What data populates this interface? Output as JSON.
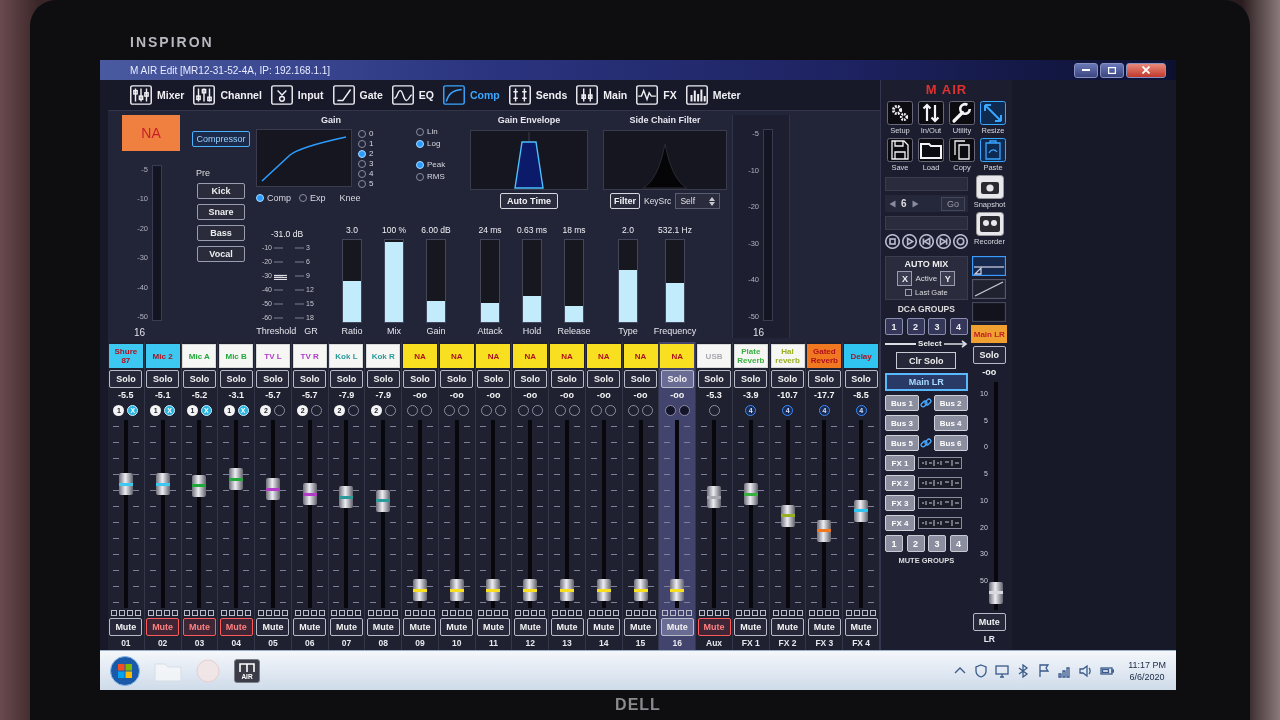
{
  "bezel": {
    "brand": "INSPIRON",
    "logo": "DELL"
  },
  "window": {
    "title": "M AIR Edit [MR12-31-52-4A, IP: 192.168.1.1]"
  },
  "tabs": [
    {
      "label": "Mixer",
      "selected": false
    },
    {
      "label": "Channel",
      "selected": false
    },
    {
      "label": "Input",
      "selected": false
    },
    {
      "label": "Gate",
      "selected": false
    },
    {
      "label": "EQ",
      "selected": false
    },
    {
      "label": "Comp",
      "selected": true
    },
    {
      "label": "Sends",
      "selected": false
    },
    {
      "label": "Main",
      "selected": false
    },
    {
      "label": "FX",
      "selected": false
    },
    {
      "label": "Meter",
      "selected": false
    }
  ],
  "channel_strip": {
    "label": "NA",
    "input_meter": {
      "scale": [
        "-5",
        "-10",
        "-20",
        "-30",
        "-40",
        "-50"
      ],
      "number": "16"
    }
  },
  "compressor": {
    "power": {
      "label": "Compressor",
      "on": true
    },
    "presets": {
      "title": "Pre",
      "buttons": [
        "Kick",
        "Snare",
        "Bass",
        "Vocal"
      ]
    },
    "gain": {
      "title": "Gain",
      "knee": [
        {
          "label": "0",
          "selected": false
        },
        {
          "label": "1",
          "selected": false
        },
        {
          "label": "2",
          "selected": true
        },
        {
          "label": "3",
          "selected": false
        },
        {
          "label": "4",
          "selected": false
        },
        {
          "label": "5",
          "selected": false
        }
      ],
      "modes": [
        {
          "label": "Comp",
          "selected": true
        },
        {
          "label": "Exp",
          "selected": false
        }
      ],
      "knee_label": "Knee"
    },
    "curve": [
      {
        "label": "Lin",
        "selected": false
      },
      {
        "label": "Log",
        "selected": true
      }
    ],
    "detector": [
      {
        "label": "Peak",
        "selected": true
      },
      {
        "label": "RMS",
        "selected": false
      }
    ],
    "envelope": {
      "title": "Gain Envelope",
      "auto_time": "Auto Time"
    },
    "sidechain": {
      "title": "Side Chain Filter",
      "filter": "Filter",
      "key_source_label": "KeySrc",
      "key_source": "Self"
    },
    "threshold": {
      "label": "Threshold",
      "value": "-31.0 dB",
      "level": 0.58,
      "scale": [
        "-10",
        "-20",
        "-30",
        "-40",
        "-50",
        "-60"
      ]
    },
    "gr": {
      "label": "GR",
      "scale": [
        "3",
        "6",
        "9",
        "12",
        "15",
        "18"
      ]
    },
    "slider_groups": [
      [
        {
          "label": "Ratio",
          "value": "3.0",
          "level": 0.5
        },
        {
          "label": "Mix",
          "value": "100 %",
          "level": 0.98
        },
        {
          "label": "Gain",
          "value": "6.00 dB",
          "level": 0.26
        }
      ],
      [
        {
          "label": "Attack",
          "value": "24 ms",
          "level": 0.23
        },
        {
          "label": "Hold",
          "value": "0.63 ms",
          "level": 0.32
        },
        {
          "label": "Release",
          "value": "18 ms",
          "level": 0.19
        }
      ],
      [
        {
          "label": "Type",
          "value": "2.0",
          "level": 0.64
        },
        {
          "label": "Frequency",
          "value": "532.1 Hz",
          "level": 0.47
        }
      ]
    ],
    "output_meter": {
      "scale": [
        "-5",
        "-10",
        "-20",
        "-30",
        "-40",
        "-50"
      ],
      "number": "16"
    }
  },
  "strips": [
    {
      "name": "Shure 87",
      "kind": "filled",
      "color": "#3cc8f0",
      "selected": false,
      "solo": "Solo",
      "value": "-5.5",
      "badges": [
        {
          "kind": "dca",
          "label": "1"
        },
        {
          "kind": "automix",
          "label": "X"
        }
      ],
      "level": 0.68,
      "mute": "Mute",
      "muted": false,
      "number": "01"
    },
    {
      "name": "Mic 2",
      "kind": "filled",
      "color": "#3cc8f0",
      "selected": false,
      "solo": "Solo",
      "value": "-5.1",
      "badges": [
        {
          "kind": "dca",
          "label": "1"
        },
        {
          "kind": "automix",
          "label": "X"
        }
      ],
      "level": 0.68,
      "mute": "Mute",
      "muted": true,
      "number": "02"
    },
    {
      "name": "Mic A",
      "kind": "text",
      "color": "#22a83a",
      "selected": false,
      "solo": "Solo",
      "value": "-5.2",
      "badges": [
        {
          "kind": "dca",
          "label": "1"
        },
        {
          "kind": "automix",
          "label": "X"
        }
      ],
      "level": 0.67,
      "mute": "Mute",
      "muted": true,
      "number": "03"
    },
    {
      "name": "Mic B",
      "kind": "text",
      "color": "#22a83a",
      "selected": false,
      "solo": "Solo",
      "value": "-3.1",
      "badges": [
        {
          "kind": "dca",
          "label": "1"
        },
        {
          "kind": "automix",
          "label": "X"
        }
      ],
      "level": 0.71,
      "mute": "Mute",
      "muted": true,
      "number": "04"
    },
    {
      "name": "TV L",
      "kind": "text",
      "color": "#b23cc8",
      "selected": false,
      "solo": "Solo",
      "value": "-5.7",
      "badges": [
        {
          "kind": "dca",
          "label": "2"
        },
        {
          "kind": "empty"
        }
      ],
      "level": 0.65,
      "mute": "Mute",
      "muted": false,
      "number": "05"
    },
    {
      "name": "TV R",
      "kind": "text",
      "color": "#b23cc8",
      "selected": false,
      "solo": "Solo",
      "value": "-5.7",
      "badges": [
        {
          "kind": "dca",
          "label": "2"
        },
        {
          "kind": "empty"
        }
      ],
      "level": 0.62,
      "mute": "Mute",
      "muted": false,
      "number": "06"
    },
    {
      "name": "Kok L",
      "kind": "text",
      "color": "#2a9a9a",
      "selected": false,
      "solo": "Solo",
      "value": "-7.9",
      "badges": [
        {
          "kind": "dca",
          "label": "2"
        },
        {
          "kind": "empty"
        }
      ],
      "level": 0.6,
      "mute": "Mute",
      "muted": false,
      "number": "07"
    },
    {
      "name": "Kok R",
      "kind": "text",
      "color": "#2a9a9a",
      "selected": false,
      "solo": "Solo",
      "value": "-7.9",
      "badges": [
        {
          "kind": "dca",
          "label": "2"
        },
        {
          "kind": "empty"
        }
      ],
      "level": 0.58,
      "mute": "Mute",
      "muted": false,
      "number": "08"
    },
    {
      "name": "NA",
      "kind": "filled",
      "color": "#f8e020",
      "selected": false,
      "solo": "Solo",
      "value": "-oo",
      "badges": [
        {
          "kind": "empty"
        },
        {
          "kind": "empty"
        }
      ],
      "level": 0.04,
      "mute": "Mute",
      "muted": false,
      "number": "09"
    },
    {
      "name": "NA",
      "kind": "filled",
      "color": "#f8e020",
      "selected": false,
      "solo": "Solo",
      "value": "-oo",
      "badges": [
        {
          "kind": "empty"
        },
        {
          "kind": "empty"
        }
      ],
      "level": 0.04,
      "mute": "Mute",
      "muted": false,
      "number": "10"
    },
    {
      "name": "NA",
      "kind": "filled",
      "color": "#f8e020",
      "selected": false,
      "solo": "Solo",
      "value": "-oo",
      "badges": [
        {
          "kind": "empty"
        },
        {
          "kind": "empty"
        }
      ],
      "level": 0.04,
      "mute": "Mute",
      "muted": false,
      "number": "11"
    },
    {
      "name": "NA",
      "kind": "filled",
      "color": "#f8e020",
      "selected": false,
      "solo": "Solo",
      "value": "-oo",
      "badges": [
        {
          "kind": "empty"
        },
        {
          "kind": "empty"
        }
      ],
      "level": 0.04,
      "mute": "Mute",
      "muted": false,
      "number": "12"
    },
    {
      "name": "NA",
      "kind": "filled",
      "color": "#f8e020",
      "selected": false,
      "solo": "Solo",
      "value": "-oo",
      "badges": [
        {
          "kind": "empty"
        },
        {
          "kind": "empty"
        }
      ],
      "level": 0.04,
      "mute": "Mute",
      "muted": false,
      "number": "13"
    },
    {
      "name": "NA",
      "kind": "filled",
      "color": "#f8e020",
      "selected": false,
      "solo": "Solo",
      "value": "-oo",
      "badges": [
        {
          "kind": "empty"
        },
        {
          "kind": "empty"
        }
      ],
      "level": 0.04,
      "mute": "Mute",
      "muted": false,
      "number": "14"
    },
    {
      "name": "NA",
      "kind": "filled",
      "color": "#f8e020",
      "selected": false,
      "solo": "Solo",
      "value": "-oo",
      "badges": [
        {
          "kind": "empty"
        },
        {
          "kind": "empty"
        }
      ],
      "level": 0.04,
      "mute": "Mute",
      "muted": false,
      "number": "15"
    },
    {
      "name": "NA",
      "kind": "filled",
      "color": "#f8e020",
      "selected": true,
      "solo": "Solo",
      "value": "-oo",
      "badges": [
        {
          "kind": "empty"
        },
        {
          "kind": "empty"
        }
      ],
      "level": 0.04,
      "mute": "Mute",
      "muted": false,
      "number": "16"
    },
    {
      "name": "USB",
      "kind": "text",
      "color": "#a8a8b0",
      "selected": false,
      "solo": "Solo",
      "value": "-5.3",
      "badges": [
        {
          "kind": "empty"
        }
      ],
      "level": 0.6,
      "mute": "Mute",
      "muted": true,
      "number": "Aux"
    },
    {
      "name": "Plate Reverb",
      "kind": "text",
      "color": "#3ab040",
      "selected": false,
      "solo": "Solo",
      "value": "-3.9",
      "badges": [
        {
          "kind": "mute_group",
          "label": "4"
        }
      ],
      "level": 0.62,
      "mute": "Mute",
      "muted": false,
      "number": "FX 1"
    },
    {
      "name": "Hal reverb",
      "kind": "text",
      "color": "#98b020",
      "selected": false,
      "solo": "Solo",
      "value": "-10.7",
      "badges": [
        {
          "kind": "mute_group",
          "label": "4"
        }
      ],
      "level": 0.49,
      "mute": "Mute",
      "muted": false,
      "number": "FX 2"
    },
    {
      "name": "Gated Reverb",
      "kind": "filled",
      "color": "#f07820",
      "selected": false,
      "solo": "Solo",
      "value": "-17.7",
      "badges": [
        {
          "kind": "mute_group",
          "label": "4"
        }
      ],
      "level": 0.4,
      "mute": "Mute",
      "muted": false,
      "number": "FX 3"
    },
    {
      "name": "Delay",
      "kind": "filled",
      "color": "#30c4f0",
      "selected": false,
      "solo": "Solo",
      "value": "-8.5",
      "badges": [
        {
          "kind": "mute_group",
          "label": "4"
        }
      ],
      "level": 0.52,
      "mute": "Mute",
      "muted": false,
      "number": "FX 4"
    }
  ],
  "side_panel": {
    "logo": "M AIR",
    "tools": [
      {
        "label": "Setup",
        "selected": false
      },
      {
        "label": "In/Out",
        "selected": false
      },
      {
        "label": "Utility",
        "selected": false
      },
      {
        "label": "Resize",
        "selected": true
      },
      {
        "label": "Save",
        "selected": false
      },
      {
        "label": "Load",
        "selected": false
      },
      {
        "label": "Copy",
        "selected": false
      },
      {
        "label": "Paste",
        "selected": true
      }
    ],
    "snapshot": {
      "number": "6",
      "go": "Go",
      "label": "Snapshot"
    },
    "recorder": {
      "label": "Recorder"
    },
    "automix": {
      "title": "AUTO MIX",
      "group_x": "X",
      "active": "Active",
      "group_y": "Y",
      "last_gate": {
        "label": "Last Gate",
        "checked": false
      }
    },
    "dca": {
      "title": "DCA GROUPS",
      "groups": [
        "1",
        "2",
        "3",
        "4"
      ],
      "select": "Select"
    },
    "clear_solo": "Clr Solo",
    "main_bus": {
      "label": "Main LR",
      "selected": true
    },
    "bus_pairs": [
      {
        "left": "Bus 1",
        "right": "Bus 2",
        "linked": true
      },
      {
        "left": "Bus 3",
        "right": "Bus 4",
        "linked": false
      },
      {
        "left": "Bus 5",
        "right": "Bus 6",
        "linked": true
      }
    ],
    "fx_sends": [
      "FX 1",
      "FX 2",
      "FX 3",
      "FX 4"
    ],
    "mute_groups": {
      "groups": [
        "1",
        "2",
        "3",
        "4"
      ],
      "title": "MUTE GROUPS"
    }
  },
  "main_strip": {
    "name": "Main LR",
    "solo": "Solo",
    "value": "-oo",
    "level": 0.03,
    "scale": [
      "10",
      "5",
      "0",
      "5",
      "10",
      "20",
      "30",
      "50"
    ],
    "mute": "Mute",
    "number": "LR"
  },
  "taskbar": {
    "app": "AIR",
    "time": "11:17 PM",
    "date": "6/6/2020"
  }
}
